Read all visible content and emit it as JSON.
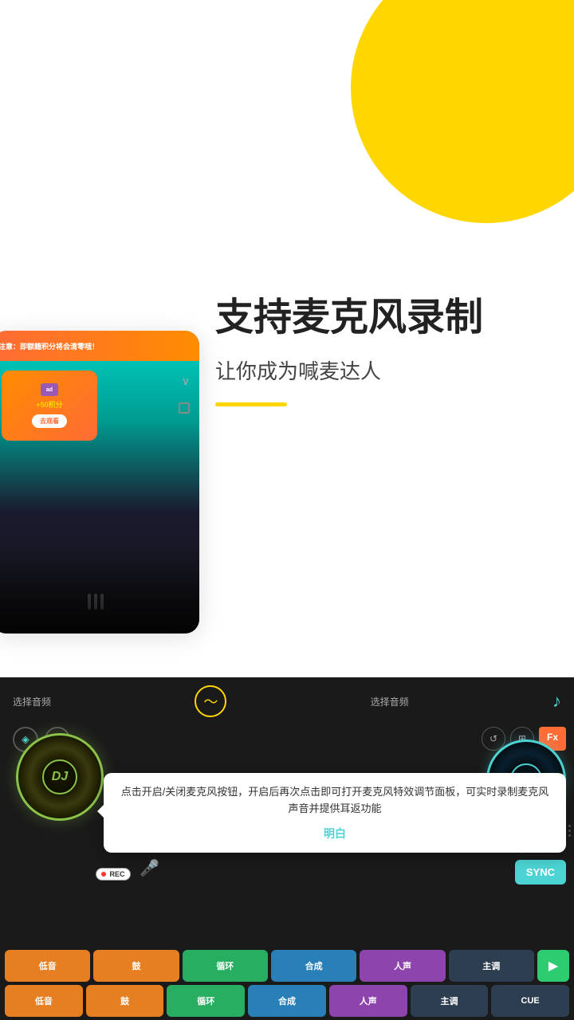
{
  "background": {
    "blob_color": "#FFD600"
  },
  "text_section": {
    "main_title": "支持麦克风录制",
    "sub_title": "让你成为喊麦达人",
    "accent_color": "#FFD600"
  },
  "mockup_top": {
    "banner_text": "注意：即额籍积分将会清零哦！",
    "ad_label": "AD",
    "points_label": "+50积分",
    "watch_btn": "去观看",
    "ad_badge": "ad"
  },
  "dj_section": {
    "header_left": "选择音频",
    "header_right": "选择音频",
    "turntable_label": "DJ",
    "tooltip": {
      "text": "点击开启/关闭麦克风按钮，开启后再次点击即可打开麦克风特效调节面板，可实时录制麦克风声音并提供耳返功能",
      "ok_label": "明白"
    },
    "rec_label": "REC",
    "sync_label": "SYNC",
    "pad_rows": [
      {
        "pads": [
          {
            "label": "低音",
            "color": "#E67E22"
          },
          {
            "label": "鼓",
            "color": "#E67E22"
          },
          {
            "label": "循环",
            "color": "#27AE60"
          },
          {
            "label": "合成",
            "color": "#3498DB"
          },
          {
            "label": "人声",
            "color": "#9B59B6"
          },
          {
            "label": "主调",
            "color": "#2C3E50"
          },
          {
            "label": "▶",
            "color": "#27AE60",
            "is_play": true
          }
        ]
      },
      {
        "pads": [
          {
            "label": "低音",
            "color": "#E67E22"
          },
          {
            "label": "鼓",
            "color": "#E67E22"
          },
          {
            "label": "循环",
            "color": "#27AE60"
          },
          {
            "label": "合成",
            "color": "#3498DB"
          },
          {
            "label": "人声",
            "color": "#9B59B6"
          },
          {
            "label": "主调",
            "color": "#2C3E50"
          },
          {
            "label": "CUE",
            "color": "#2C3E50"
          }
        ]
      }
    ]
  }
}
